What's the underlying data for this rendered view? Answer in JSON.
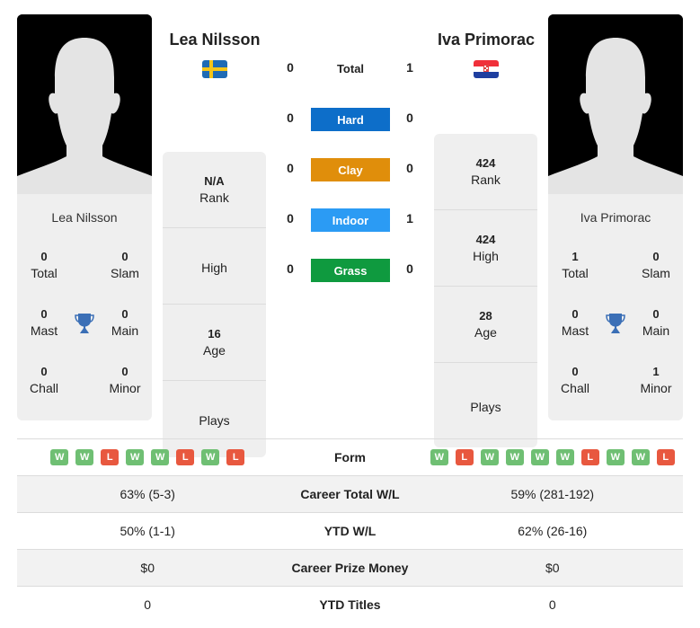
{
  "colors": {
    "win": "#6fbf73",
    "loss": "#e8583f",
    "hard": "#0d6ec9",
    "clay": "#e08e0b",
    "indoor": "#2b9bf4",
    "grass": "#0f9a3f",
    "trophy": "#3b6fb6"
  },
  "player1": {
    "name": "Lea Nilsson",
    "country_flag": "sweden-flag",
    "card_name": "Lea Nilsson",
    "titles": {
      "total": {
        "value": "0",
        "label": "Total"
      },
      "slam": {
        "value": "0",
        "label": "Slam"
      },
      "mast": {
        "value": "0",
        "label": "Mast"
      },
      "main": {
        "value": "0",
        "label": "Main"
      },
      "chall": {
        "value": "0",
        "label": "Chall"
      },
      "minor": {
        "value": "0",
        "label": "Minor"
      }
    },
    "rank": {
      "value": "N/A",
      "label": "Rank"
    },
    "high": {
      "value": "",
      "label": "High"
    },
    "age": {
      "value": "16",
      "label": "Age"
    },
    "plays": {
      "value": "",
      "label": "Plays"
    }
  },
  "player2": {
    "name": "Iva Primorac",
    "country_flag": "croatia-flag",
    "card_name": "Iva Primorac",
    "titles": {
      "total": {
        "value": "1",
        "label": "Total"
      },
      "slam": {
        "value": "0",
        "label": "Slam"
      },
      "mast": {
        "value": "0",
        "label": "Mast"
      },
      "main": {
        "value": "0",
        "label": "Main"
      },
      "chall": {
        "value": "0",
        "label": "Chall"
      },
      "minor": {
        "value": "1",
        "label": "Minor"
      }
    },
    "rank": {
      "value": "424",
      "label": "Rank"
    },
    "high": {
      "value": "424",
      "label": "High"
    },
    "age": {
      "value": "28",
      "label": "Age"
    },
    "plays": {
      "value": "",
      "label": "Plays"
    }
  },
  "h2h": {
    "total": {
      "label": "Total",
      "p1": "0",
      "p2": "1"
    },
    "surfaces": [
      {
        "label": "Hard",
        "p1": "0",
        "p2": "0"
      },
      {
        "label": "Clay",
        "p1": "0",
        "p2": "0"
      },
      {
        "label": "Indoor",
        "p1": "0",
        "p2": "1"
      },
      {
        "label": "Grass",
        "p1": "0",
        "p2": "0"
      }
    ]
  },
  "stats": {
    "form": {
      "label": "Form",
      "p1": [
        "W",
        "W",
        "L",
        "W",
        "W",
        "L",
        "W",
        "L"
      ],
      "p2": [
        "W",
        "L",
        "W",
        "W",
        "W",
        "W",
        "L",
        "W",
        "W",
        "L"
      ]
    },
    "rows": [
      {
        "label": "Career Total W/L",
        "p1": "63% (5-3)",
        "p2": "59% (281-192)"
      },
      {
        "label": "YTD W/L",
        "p1": "50% (1-1)",
        "p2": "62% (26-16)"
      },
      {
        "label": "Career Prize Money",
        "p1": "$0",
        "p2": "$0"
      },
      {
        "label": "YTD Titles",
        "p1": "0",
        "p2": "0"
      }
    ]
  }
}
